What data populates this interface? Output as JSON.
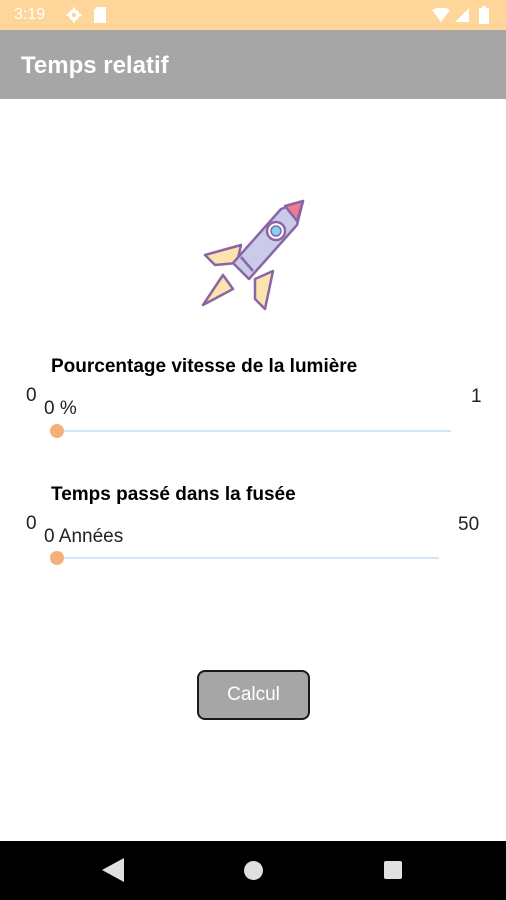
{
  "status_bar": {
    "time": "3:19"
  },
  "app_bar": {
    "title": "Temps relatif"
  },
  "speed": {
    "label": "Pourcentage vitesse de la lumière",
    "min": "0",
    "max": "1",
    "value_text": "0 %",
    "level": 0
  },
  "time": {
    "label": "Temps passé dans la fusée",
    "min": "0",
    "max": "50",
    "value_text": "0 Années",
    "level": 0
  },
  "calc_button": {
    "label": "Calcul"
  },
  "colors": {
    "status_bar": "#ffd699",
    "app_bar": "#a6a6a6",
    "slider_thumb": "#f5b07a",
    "slider_track": "#d6e4f7"
  }
}
